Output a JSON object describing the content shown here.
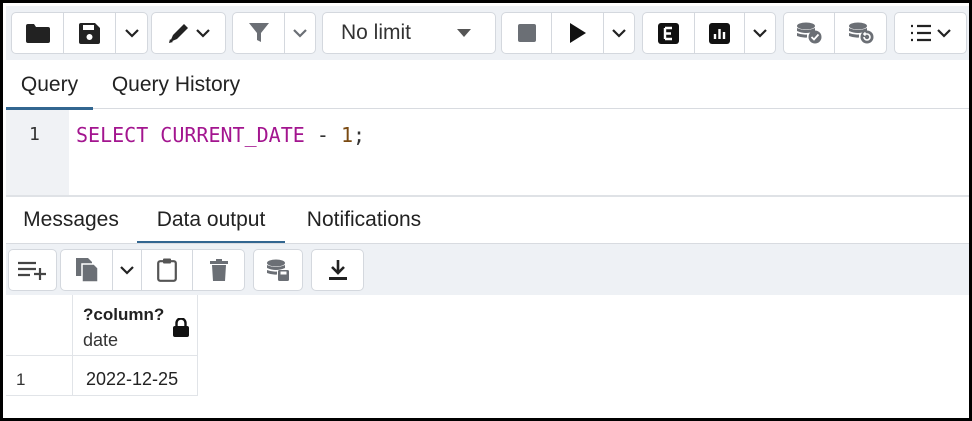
{
  "toolbar": {
    "limit_select": {
      "selected": "No limit"
    },
    "icons": [
      "folder-icon",
      "save-icon",
      "chevron-down-icon",
      "edit-icon",
      "filter-icon",
      "stop-icon",
      "play-icon",
      "explain-icon",
      "analyze-icon",
      "commit-icon",
      "rollback-icon",
      "macros-icon"
    ]
  },
  "query_tabs": [
    {
      "label": "Query",
      "active": true
    },
    {
      "label": "Query History",
      "active": false
    }
  ],
  "editor": {
    "line_number": "1",
    "tokens": {
      "kw1": "SELECT",
      "kw2": "CURRENT_DATE",
      "op": "-",
      "num": "1",
      "end": ";"
    }
  },
  "result_tabs": [
    {
      "label": "Messages",
      "active": false
    },
    {
      "label": "Data output",
      "active": true
    },
    {
      "label": "Notifications",
      "active": false
    }
  ],
  "result_toolbar": {
    "icons": [
      "add-row-icon",
      "copy-icon",
      "chevron-down-icon",
      "paste-icon",
      "delete-icon",
      "save-data-icon",
      "download-icon"
    ]
  },
  "grid": {
    "column": {
      "name": "?column?",
      "type": "date",
      "icon": "lock-icon"
    },
    "rows": [
      {
        "num": "1",
        "value": "2022-12-25"
      }
    ]
  },
  "colors": {
    "accent": "#326690",
    "keyword": "#a3158f",
    "number": "#7a4a12"
  }
}
